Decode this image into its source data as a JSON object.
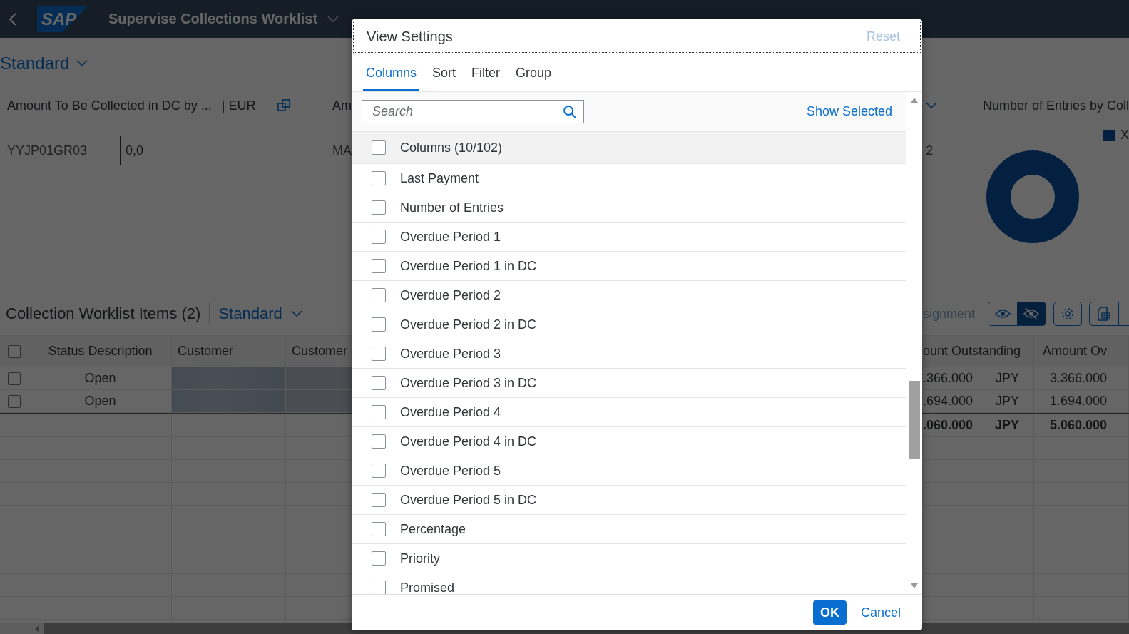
{
  "shell": {
    "logo": "SAP",
    "title": "Supervise Collections Worklist"
  },
  "variant": {
    "label": "Standard"
  },
  "kpi_cards": [
    {
      "title": "Amount To Be Collected in DC by ...",
      "unit": "| EUR",
      "label": "YYJP01GR03",
      "value": "0,0"
    },
    {
      "title": "Am",
      "label": "MA"
    },
    {
      "value": "2"
    }
  ],
  "chart_card": {
    "title": "Number of Entries by Coll",
    "legend": [
      "X"
    ]
  },
  "table": {
    "title": "Collection Worklist Items (2)",
    "variant": "Standard",
    "toolbar_link": "signment",
    "select_all": {
      "checked": false
    },
    "view_toggle": [
      {
        "selected": false
      },
      {
        "selected": true
      }
    ],
    "columns": [
      "Status Description",
      "Customer",
      "Customer",
      "ount Outstanding",
      "Amount Ov"
    ],
    "rows": [
      {
        "checked": false,
        "status": "Open",
        "outstanding": ".366.000",
        "currency": "JPY",
        "overdue": "3.366.000"
      },
      {
        "checked": false,
        "status": "Open",
        "outstanding": ".694.000",
        "currency": "JPY",
        "overdue": "1.694.000"
      }
    ],
    "total": {
      "outstanding": ".060.000",
      "currency": "JPY",
      "overdue": "5.060.000"
    }
  },
  "dialog": {
    "title": "View Settings",
    "reset": {
      "label": "Reset",
      "disabled": true
    },
    "tabs": [
      {
        "label": "Columns",
        "selected": true
      },
      {
        "label": "Sort",
        "selected": false
      },
      {
        "label": "Filter",
        "selected": false
      },
      {
        "label": "Group",
        "selected": false
      }
    ],
    "search": {
      "placeholder": "Search"
    },
    "show_selected": "Show Selected",
    "select_all": {
      "label": "Columns (10/102)",
      "checked": false
    },
    "items": [
      {
        "label": "Last Payment",
        "checked": false
      },
      {
        "label": "Number of Entries",
        "checked": false
      },
      {
        "label": "Overdue Period 1",
        "checked": false
      },
      {
        "label": "Overdue Period 1 in DC",
        "checked": false
      },
      {
        "label": "Overdue Period 2",
        "checked": false
      },
      {
        "label": "Overdue Period 2 in DC",
        "checked": false
      },
      {
        "label": "Overdue Period 3",
        "checked": false
      },
      {
        "label": "Overdue Period 3 in DC",
        "checked": false
      },
      {
        "label": "Overdue Period 4",
        "checked": false
      },
      {
        "label": "Overdue Period 4 in DC",
        "checked": false
      },
      {
        "label": "Overdue Period 5",
        "checked": false
      },
      {
        "label": "Overdue Period 5 in DC",
        "checked": false
      },
      {
        "label": "Percentage",
        "checked": false
      },
      {
        "label": "Priority",
        "checked": false
      },
      {
        "label": "Promised",
        "checked": false
      }
    ],
    "buttons": [
      {
        "label": "OK",
        "kind": "emphasized"
      },
      {
        "label": "Cancel",
        "kind": "transparent"
      }
    ]
  }
}
